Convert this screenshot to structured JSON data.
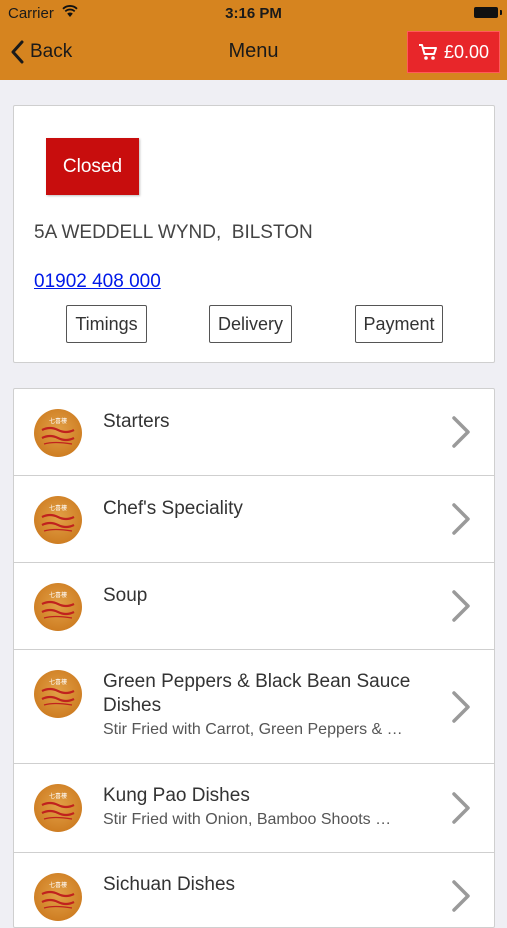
{
  "status_bar": {
    "carrier": "Carrier",
    "time": "3:16 PM"
  },
  "nav": {
    "back_label": "Back",
    "title": "Menu",
    "cart_label": "£0.00"
  },
  "info": {
    "status": "Closed",
    "address": "5A WEDDELL WYND,  BILSTON",
    "phone": "01902 408 000",
    "buttons": {
      "timings": "Timings",
      "delivery": "Delivery",
      "payment": "Payment"
    }
  },
  "menu": {
    "items": [
      {
        "title": "Starters",
        "desc": ""
      },
      {
        "title": "Chef's Speciality",
        "desc": ""
      },
      {
        "title": "Soup",
        "desc": ""
      },
      {
        "title": "Green Peppers & Black Bean Sauce Dishes",
        "desc": "Stir Fried with Carrot, Green Peppers & …"
      },
      {
        "title": "Kung Pao Dishes",
        "desc": "Stir Fried with Onion, Bamboo Shoots …"
      },
      {
        "title": "Sichuan Dishes",
        "desc": ""
      }
    ]
  },
  "colors": {
    "nav_bg": "#d6841f",
    "cart_bg": "#e8262a",
    "closed_bg": "#c80d0d",
    "link": "#0019e8"
  }
}
